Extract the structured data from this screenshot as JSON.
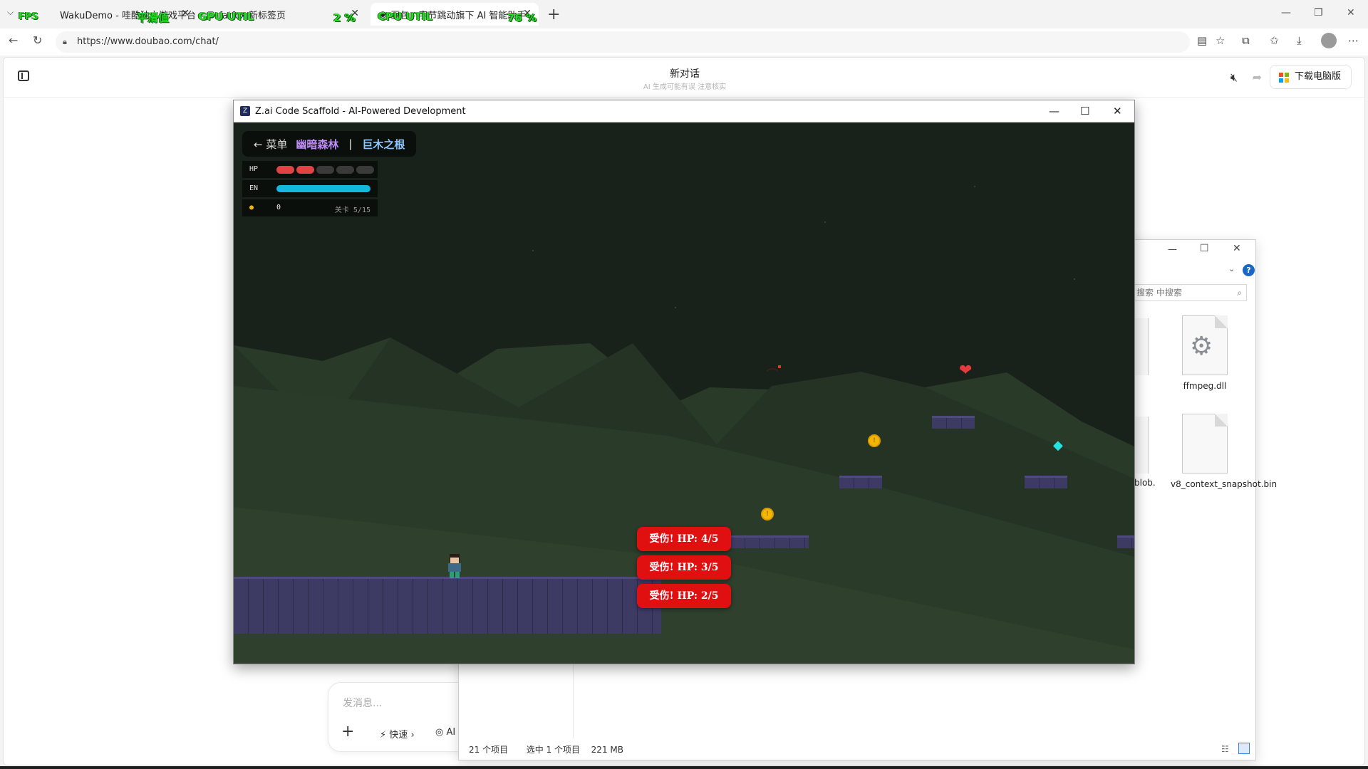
{
  "browser": {
    "tabs": [
      {
        "label": "WakuDemo - 哇酷独立游戏平台",
        "active": false
      },
      {
        "label": "fatfox 新标签页",
        "active": false
      },
      {
        "label": "豆包 - 字节跳动旗下 AI 智能助手",
        "active": true
      }
    ],
    "overlay": {
      "fps_label": "FPS",
      "fps_value": "平滑值",
      "gpu_label": "GPU UTIL",
      "gpu_value": "2 %",
      "cpu_label": "CPU UTIL",
      "cpu_value": "76 %"
    },
    "url": "https://www.doubao.com/chat/"
  },
  "doubao": {
    "chat_title": "新对话",
    "chat_subtitle": "AI 生成可能有误 注意核实",
    "download_label": "下载电脑版",
    "composer": {
      "placeholder": "发消息...",
      "fast_label": "快速",
      "ai_label": "AI"
    }
  },
  "explorer": {
    "search_placeholder": "搜索 中搜索",
    "files": [
      {
        "name": "ffmpeg.dll",
        "icon": "gear-file-icon"
      },
      {
        "name": "v8_context_snapshot.bin",
        "icon": "blank-file-icon"
      }
    ],
    "partial_file_label": "blob.",
    "status": {
      "count": "21 个项目",
      "selected": "选中 1 个项目",
      "size": "221 MB"
    }
  },
  "game_window": {
    "title": "Z.ai Code Scaffold - AI-Powered Development",
    "hud": {
      "back_label": "← 菜单",
      "world_name": "幽暗森林",
      "separator": "|",
      "level_name": "巨木之根",
      "hp_label": "HP",
      "hp_current": 2,
      "hp_max": 5,
      "en_label": "EN",
      "en_fraction": 1.0,
      "coin_count": "0",
      "stage_label": "关卡 5/15"
    },
    "toasts": [
      "受伤! HP: 4/5",
      "受伤! HP: 3/5",
      "受伤! HP: 2/5"
    ],
    "colors": {
      "hp_full": "#e04343",
      "hp_empty": "#3a3a3a",
      "energy": "#14b8dc",
      "toast_bg": "#e01010",
      "platform": "#3d3a64"
    }
  }
}
